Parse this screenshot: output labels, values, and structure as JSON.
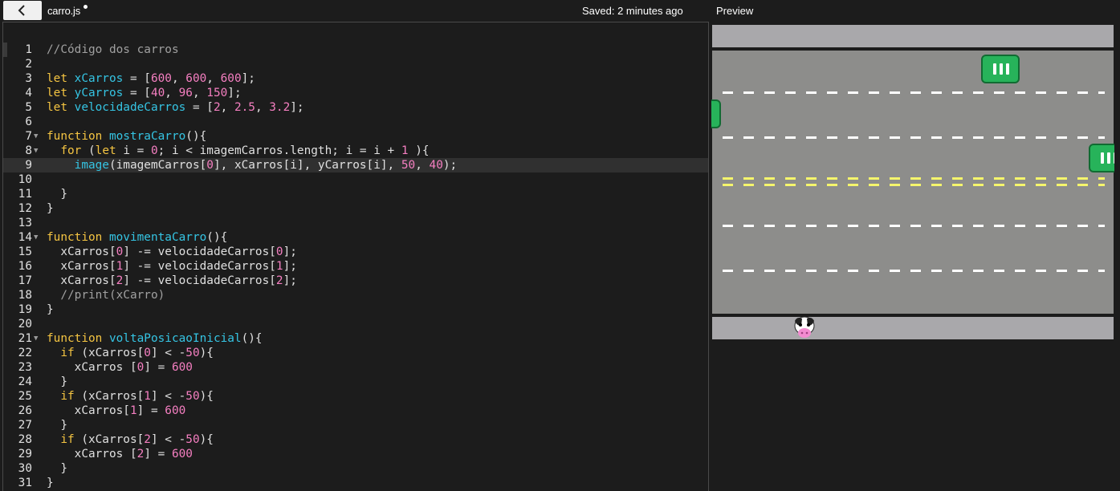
{
  "header": {
    "file_name": "carro.js",
    "saved_status": "Saved: 2 minutes ago",
    "preview_label": "Preview"
  },
  "icons": {
    "back": "chevron-left-icon",
    "unsaved": "unsaved-dot"
  },
  "colors": {
    "keyword": "#f5c542",
    "identifier": "#35c5e4",
    "number": "#f57fc1",
    "comment": "#a0a0a0",
    "text": "#e0e0e0",
    "road": "#8d8d8b",
    "sidewalk": "#a9a8ab",
    "car": "#27b35a"
  },
  "editor": {
    "active_line": 9,
    "lines": [
      {
        "n": "1",
        "fold": "",
        "tokens": [
          [
            "cm",
            "//Código dos carros"
          ]
        ]
      },
      {
        "n": "2",
        "fold": "",
        "tokens": []
      },
      {
        "n": "3",
        "fold": "",
        "tokens": [
          [
            "kw",
            "let "
          ],
          [
            "var",
            "xCarros"
          ],
          [
            "",
            " = ["
          ],
          [
            "num",
            "600"
          ],
          [
            "",
            ", "
          ],
          [
            "num",
            "600"
          ],
          [
            "",
            ", "
          ],
          [
            "num",
            "600"
          ],
          [
            "",
            "];"
          ]
        ]
      },
      {
        "n": "4",
        "fold": "",
        "tokens": [
          [
            "kw",
            "let "
          ],
          [
            "var",
            "yCarros"
          ],
          [
            "",
            " = ["
          ],
          [
            "num",
            "40"
          ],
          [
            "",
            ", "
          ],
          [
            "num",
            "96"
          ],
          [
            "",
            ", "
          ],
          [
            "num",
            "150"
          ],
          [
            "",
            "];"
          ]
        ]
      },
      {
        "n": "5",
        "fold": "",
        "tokens": [
          [
            "kw",
            "let "
          ],
          [
            "var",
            "velocidadeCarros"
          ],
          [
            "",
            " = ["
          ],
          [
            "num",
            "2"
          ],
          [
            "",
            ", "
          ],
          [
            "num",
            "2.5"
          ],
          [
            "",
            ", "
          ],
          [
            "num",
            "3.2"
          ],
          [
            "",
            "];"
          ]
        ]
      },
      {
        "n": "6",
        "fold": "",
        "tokens": []
      },
      {
        "n": "7",
        "fold": "▼",
        "tokens": [
          [
            "kw",
            "function "
          ],
          [
            "fn",
            "mostraCarro"
          ],
          [
            "",
            "(){"
          ]
        ]
      },
      {
        "n": "8",
        "fold": "▼",
        "tokens": [
          [
            "",
            "  "
          ],
          [
            "kw",
            "for"
          ],
          [
            "",
            " ("
          ],
          [
            "kw",
            "let "
          ],
          [
            "",
            "i = "
          ],
          [
            "num",
            "0"
          ],
          [
            "",
            "; i < imagemCarros.length; i = i + "
          ],
          [
            "num",
            "1"
          ],
          [
            "",
            " ){"
          ]
        ]
      },
      {
        "n": "9",
        "fold": "",
        "tokens": [
          [
            "",
            "    "
          ],
          [
            "fn",
            "image"
          ],
          [
            "",
            "(imagemCarros["
          ],
          [
            "num",
            "0"
          ],
          [
            "",
            "], xCarros[i], yCarros[i], "
          ],
          [
            "num",
            "50"
          ],
          [
            "",
            ", "
          ],
          [
            "num",
            "40"
          ],
          [
            "",
            ");"
          ]
        ]
      },
      {
        "n": "10",
        "fold": "",
        "tokens": []
      },
      {
        "n": "11",
        "fold": "",
        "tokens": [
          [
            "",
            "  }"
          ]
        ]
      },
      {
        "n": "12",
        "fold": "",
        "tokens": [
          [
            "",
            "}"
          ]
        ]
      },
      {
        "n": "13",
        "fold": "",
        "tokens": []
      },
      {
        "n": "14",
        "fold": "▼",
        "tokens": [
          [
            "kw",
            "function "
          ],
          [
            "fn",
            "movimentaCarro"
          ],
          [
            "",
            "(){"
          ]
        ]
      },
      {
        "n": "15",
        "fold": "",
        "tokens": [
          [
            "",
            "  xCarros["
          ],
          [
            "num",
            "0"
          ],
          [
            "",
            "] -= velocidadeCarros["
          ],
          [
            "num",
            "0"
          ],
          [
            "",
            "];"
          ]
        ]
      },
      {
        "n": "16",
        "fold": "",
        "tokens": [
          [
            "",
            "  xCarros["
          ],
          [
            "num",
            "1"
          ],
          [
            "",
            "] -= velocidadeCarros["
          ],
          [
            "num",
            "1"
          ],
          [
            "",
            "];"
          ]
        ]
      },
      {
        "n": "17",
        "fold": "",
        "tokens": [
          [
            "",
            "  xCarros["
          ],
          [
            "num",
            "2"
          ],
          [
            "",
            "] -= velocidadeCarros["
          ],
          [
            "num",
            "2"
          ],
          [
            "",
            "];"
          ]
        ]
      },
      {
        "n": "18",
        "fold": "",
        "tokens": [
          [
            "cm",
            "  //print(xCarro)"
          ]
        ]
      },
      {
        "n": "19",
        "fold": "",
        "tokens": [
          [
            "",
            "}"
          ]
        ]
      },
      {
        "n": "20",
        "fold": "",
        "tokens": []
      },
      {
        "n": "21",
        "fold": "▼",
        "tokens": [
          [
            "kw",
            "function "
          ],
          [
            "fn",
            "voltaPosicaoInicial"
          ],
          [
            "",
            "(){"
          ]
        ]
      },
      {
        "n": "22",
        "fold": "",
        "tokens": [
          [
            "",
            "  "
          ],
          [
            "kw",
            "if"
          ],
          [
            "",
            " (xCarros["
          ],
          [
            "num",
            "0"
          ],
          [
            "",
            "] < -"
          ],
          [
            "num",
            "50"
          ],
          [
            "",
            "){"
          ]
        ]
      },
      {
        "n": "23",
        "fold": "",
        "tokens": [
          [
            "",
            "    xCarros ["
          ],
          [
            "num",
            "0"
          ],
          [
            "",
            "] = "
          ],
          [
            "num",
            "600"
          ]
        ]
      },
      {
        "n": "24",
        "fold": "",
        "tokens": [
          [
            "",
            "  }"
          ]
        ]
      },
      {
        "n": "25",
        "fold": "",
        "tokens": [
          [
            "",
            "  "
          ],
          [
            "kw",
            "if"
          ],
          [
            "",
            " (xCarros["
          ],
          [
            "num",
            "1"
          ],
          [
            "",
            "] < -"
          ],
          [
            "num",
            "50"
          ],
          [
            "",
            "){"
          ]
        ]
      },
      {
        "n": "26",
        "fold": "",
        "tokens": [
          [
            "",
            "    xCarros["
          ],
          [
            "num",
            "1"
          ],
          [
            "",
            "] = "
          ],
          [
            "num",
            "600"
          ]
        ]
      },
      {
        "n": "27",
        "fold": "",
        "tokens": [
          [
            "",
            "  }"
          ]
        ]
      },
      {
        "n": "28",
        "fold": "",
        "tokens": [
          [
            "",
            "  "
          ],
          [
            "kw",
            "if"
          ],
          [
            "",
            " (xCarros["
          ],
          [
            "num",
            "2"
          ],
          [
            "",
            "] < -"
          ],
          [
            "num",
            "50"
          ],
          [
            "",
            "){"
          ]
        ]
      },
      {
        "n": "29",
        "fold": "",
        "tokens": [
          [
            "",
            "    xCarros ["
          ],
          [
            "num",
            "2"
          ],
          [
            "",
            "] = "
          ],
          [
            "num",
            "600"
          ]
        ]
      },
      {
        "n": "30",
        "fold": "",
        "tokens": [
          [
            "",
            "  }"
          ]
        ]
      },
      {
        "n": "31",
        "fold": "",
        "tokens": [
          [
            "",
            "}"
          ]
        ]
      }
    ]
  },
  "preview": {
    "lane_markings": [
      "white",
      "white",
      "yellow",
      "yellow",
      "white",
      "white"
    ],
    "sprites": [
      "car",
      "car",
      "car",
      "cow"
    ]
  }
}
